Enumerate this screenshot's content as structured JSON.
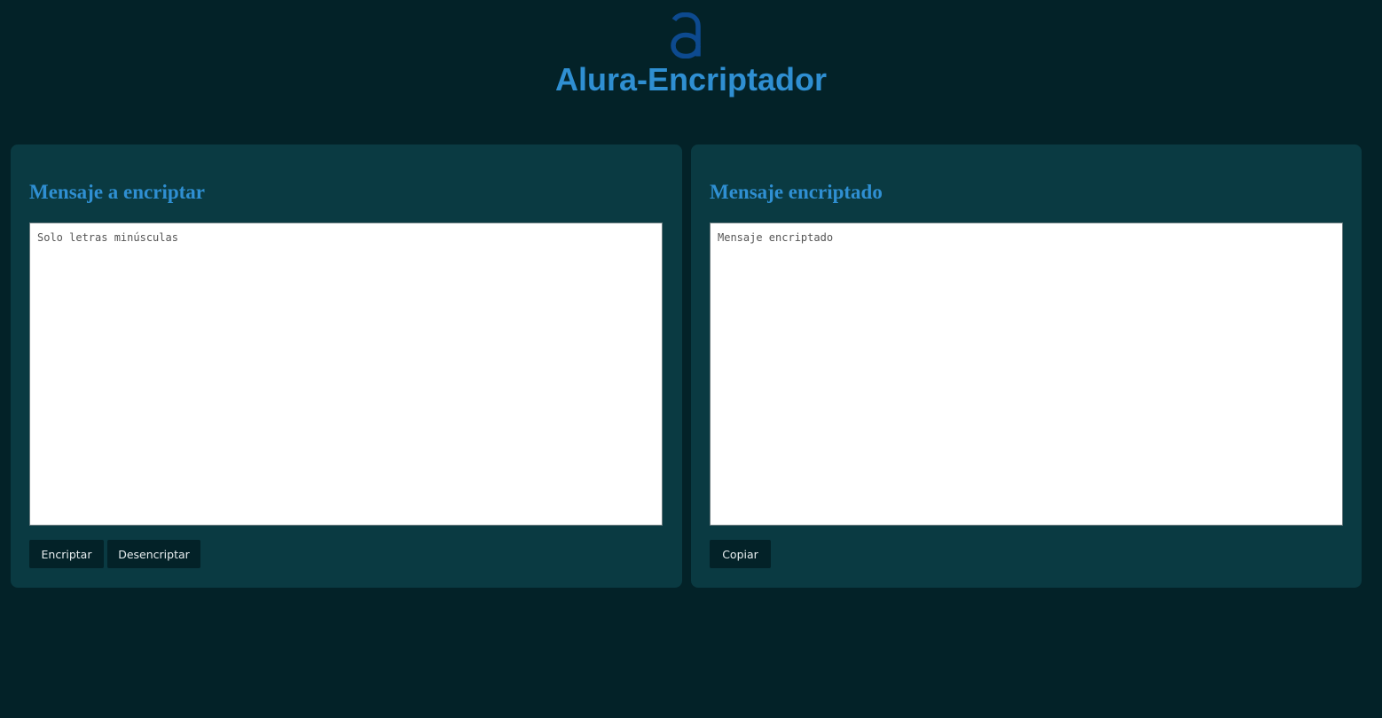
{
  "colors": {
    "background": "#032228",
    "panel": "#0a3a42",
    "accent": "#2f8fd2",
    "logo": "#0d4a8f",
    "button": "#032228",
    "button_text": "#e8eef0"
  },
  "header": {
    "logo_icon": "alura-a-logo-icon",
    "title": "Alura-Encriptador"
  },
  "input_panel": {
    "title": "Mensaje a encriptar",
    "textarea": {
      "value": "",
      "placeholder": "Solo letras minúsculas"
    },
    "buttons": {
      "encrypt_label": "Encriptar",
      "decrypt_label": "Desencriptar"
    }
  },
  "output_panel": {
    "title": "Mensaje encriptado",
    "textarea": {
      "value": "",
      "placeholder": "Mensaje encriptado"
    },
    "buttons": {
      "copy_label": "Copiar"
    }
  }
}
